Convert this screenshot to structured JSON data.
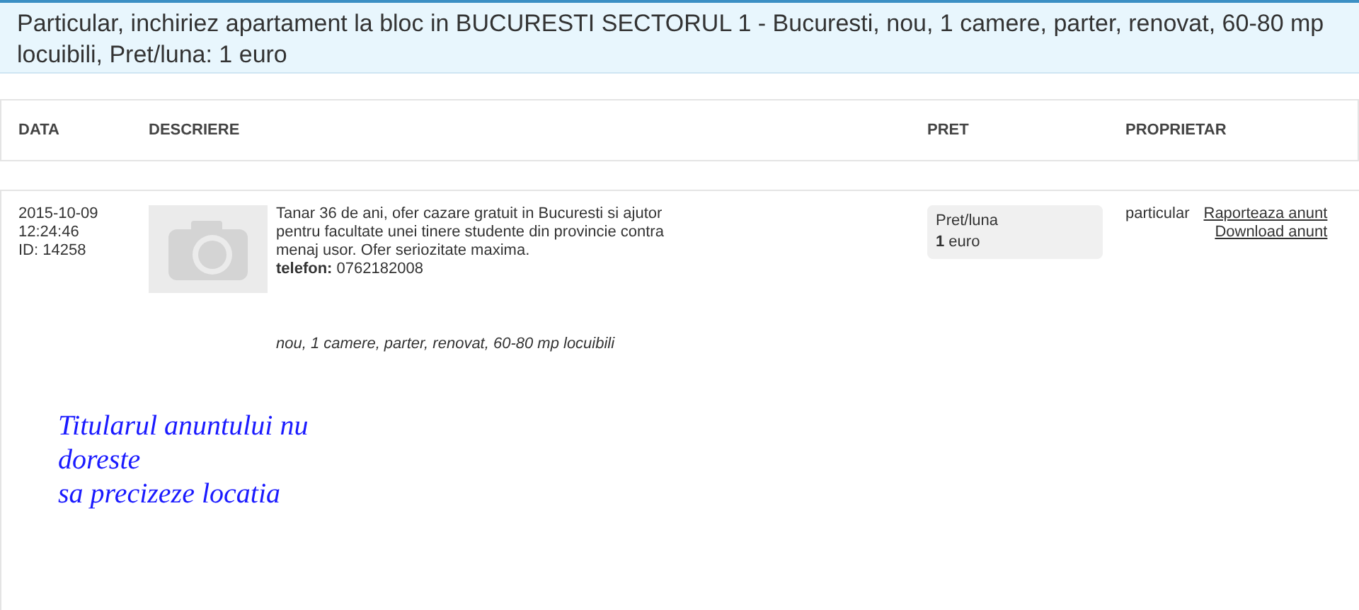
{
  "title": "Particular, inchiriez apartament la bloc in BUCURESTI SECTORUL 1 - Bucuresti, nou, 1 camere, parter, renovat, 60-80 mp locuibili, Pret/luna: 1 euro",
  "columns": [
    "DATA",
    "DESCRIERE",
    "PRET",
    "PROPRIETAR"
  ],
  "listing": {
    "date": "2015-10-09",
    "time": "12:24:46",
    "id": "ID: 14258",
    "description": "Tanar 36 de ani, ofer cazare gratuit in Bucuresti si ajutor pentru facultate unei tinere studente din provincie contra menaj usor. Ofer seriozitate maxima.",
    "phone": "**telefon:** 0762182008",
    "features": "nou, 1 camere, parter, renovat, 60-80 mp locuibili",
    "price_label": "Pret/luna",
    "price": "**1** euro",
    "owner": "particular",
    "links": [
      "Raporteaza anunt",
      "Download anunt"
    ],
    "location_note": [
      "Titularul anuntului nu",
      "doreste",
      "sa precizeze locatia"
    ]
  }
}
